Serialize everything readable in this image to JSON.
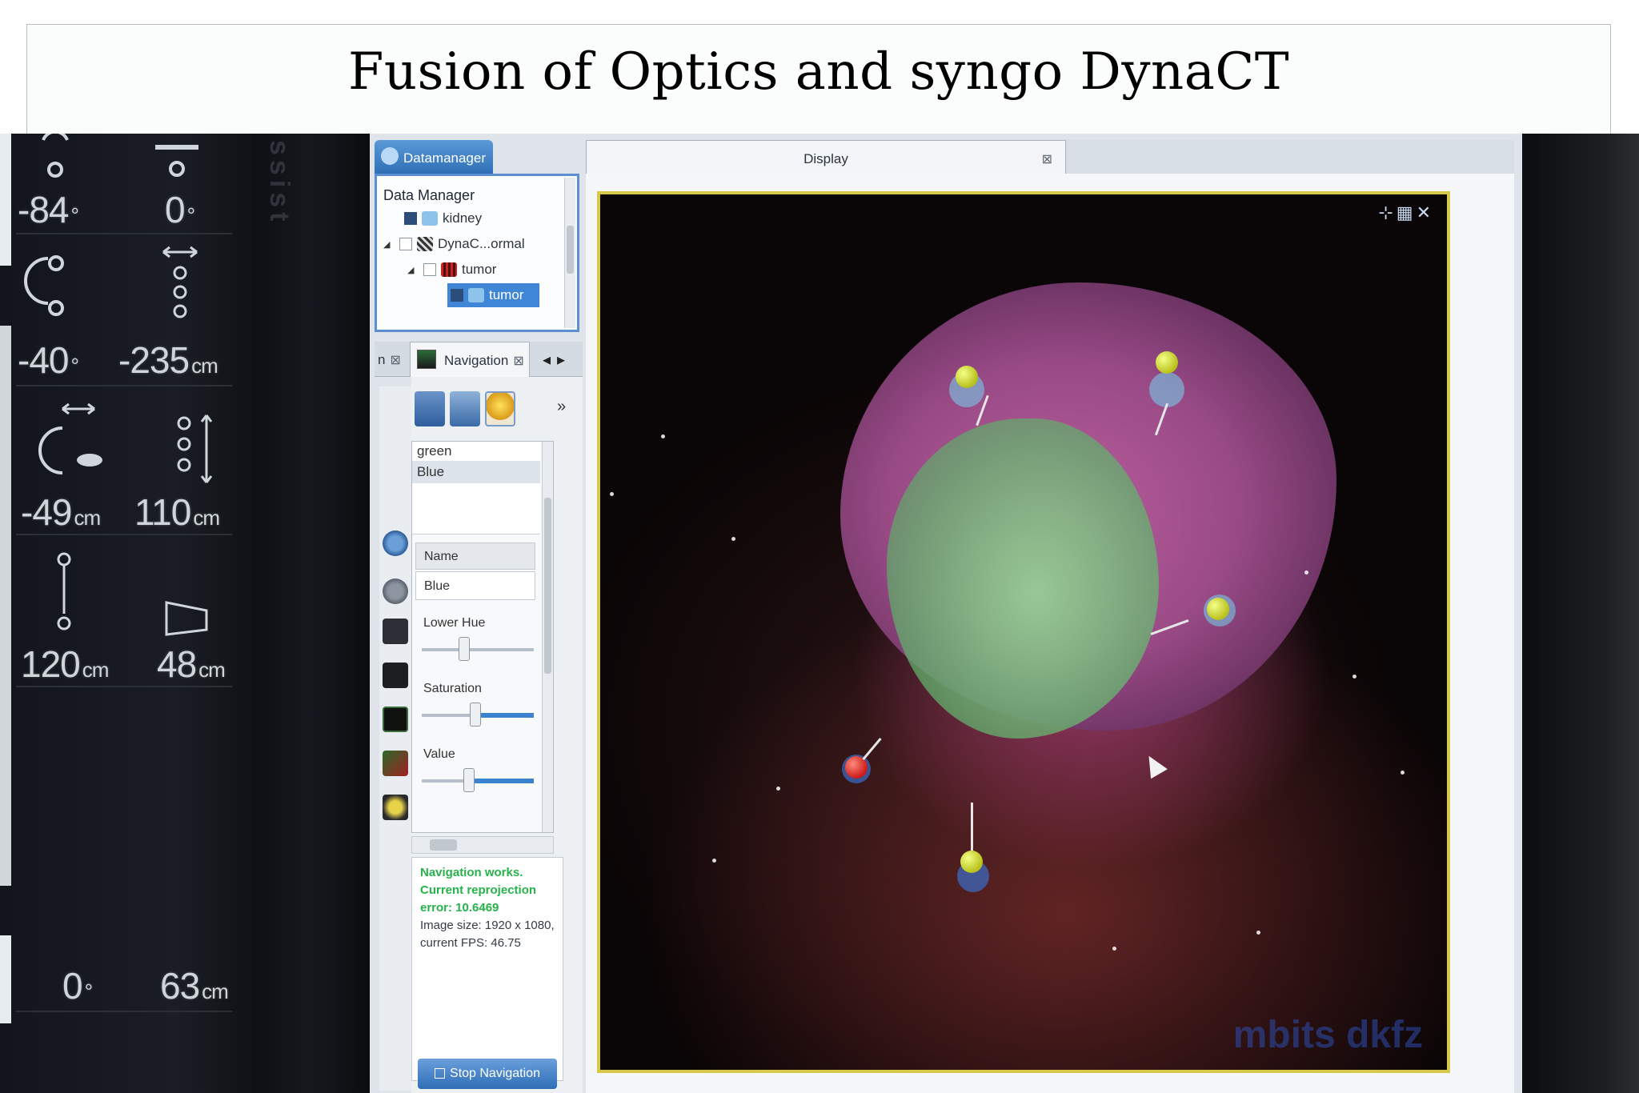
{
  "slide": {
    "title": "Fusion of Optics and syngo DynaCT"
  },
  "left_monitor": {
    "readouts": [
      {
        "value": "-84",
        "unit": "°"
      },
      {
        "value": "0",
        "unit": "°"
      },
      {
        "value": "-40",
        "unit": "°"
      },
      {
        "value": "-235",
        "unit": "cm"
      },
      {
        "value": "-49",
        "unit": "cm"
      },
      {
        "value": "110",
        "unit": "cm"
      },
      {
        "value": "120",
        "unit": "cm"
      },
      {
        "value": "48",
        "unit": "cm"
      },
      {
        "value": "0",
        "unit": "°"
      },
      {
        "value": "63",
        "unit": "cm"
      }
    ],
    "bezel_text": "ssist"
  },
  "data_manager": {
    "tab_label": "Datamanager",
    "title": "Data Manager",
    "tree": [
      {
        "label": "kidney"
      },
      {
        "label": "DynaC...ormal"
      },
      {
        "label": "tumor"
      },
      {
        "label": "tumor"
      }
    ]
  },
  "navigation": {
    "partial_tab_label": "n",
    "tab_label": "Navigation",
    "color_list": [
      "green",
      "Blue"
    ],
    "name_header": "Name",
    "name_value": "Blue",
    "lower_hue_label": "Lower Hue",
    "saturation_label": "Saturation",
    "value_label": "Value",
    "lower_hue_level": 0.38,
    "saturation_level": 0.48,
    "value_level": 0.42,
    "status_ok": "Navigation works. Current reprojection error: 10.6469",
    "status_info": "Image size: 1920 x 1080, current FPS: 46.75",
    "stop_button": "Stop Navigation"
  },
  "display": {
    "tab_label": "Display",
    "watermark": "mbits dkfz"
  },
  "icons": {
    "help": "question-icon",
    "camera": "camera-icon",
    "settings": "settings-icon"
  },
  "colors": {
    "accent_blue": "#3b82d1",
    "status_green": "#25b34a",
    "frame_yellow": "#d6c949"
  }
}
